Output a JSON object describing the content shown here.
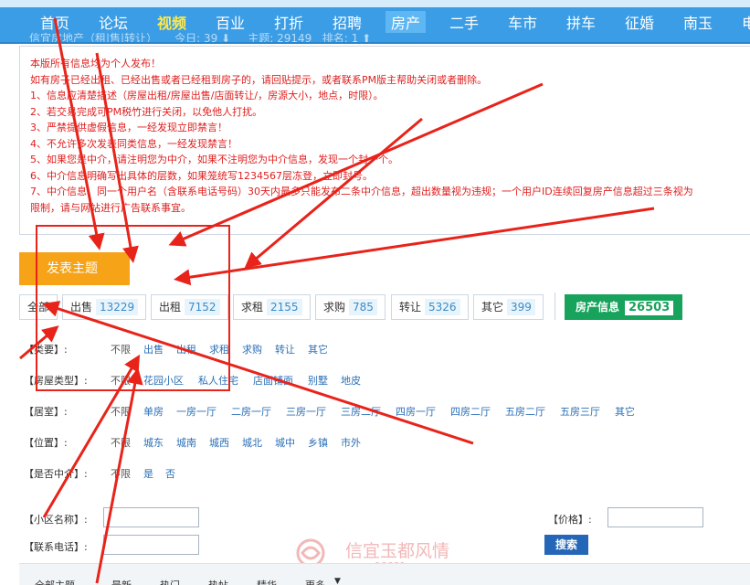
{
  "nav": {
    "items": [
      {
        "label": "首页",
        "style": "normal"
      },
      {
        "label": "论坛",
        "style": "normal"
      },
      {
        "label": "视频",
        "style": "hot"
      },
      {
        "label": "百业",
        "style": "normal"
      },
      {
        "label": "打折",
        "style": "normal"
      },
      {
        "label": "招聘",
        "style": "normal"
      },
      {
        "label": "房产",
        "style": "active"
      },
      {
        "label": "二手",
        "style": "normal"
      },
      {
        "label": "车市",
        "style": "normal"
      },
      {
        "label": "拼车",
        "style": "normal"
      },
      {
        "label": "征婚",
        "style": "normal"
      },
      {
        "label": "南玉",
        "style": "normal"
      },
      {
        "label": "电",
        "style": "normal"
      }
    ]
  },
  "forum": {
    "title": "信宜房地产（租|售|转让）",
    "today": "今日: 39",
    "topics": "主题: 29149",
    "rank": "排名: 1"
  },
  "notice": {
    "lines": [
      "本版所有信息均为个人发布！",
      "如有房子已经出租、已经出售或者已经租到房子的，请回贴提示，或者联系PM版主帮助关闭或者删除。",
      "1、信息应清楚描述（房屋出租/房屋出售/店面转让/，房源大小，地点，时限）。",
      "2、若交易完成可PM税竹进行关闭，以免他人打扰。",
      "3、严禁提供虚假信息，一经发现立即禁言！",
      "4、不允许多次发表同类信息，一经发现禁言！",
      "5、如果您是中介，请注明您为中介，如果不注明您为中介信息，发现一个封一个。",
      "6、中介信息明确写出具体的层数，如果笼统写1234567层冻登，立即封号。",
      "7、中介信息，同一个用户名（含联系电话号码）30天内最多只能发布二条中介信息，超出数量视为违规；一个用户ID连续回复房产信息超过三条视为",
      "限制，请与网站进行广告联系事宜。"
    ]
  },
  "post_button": "发表主题",
  "categories": [
    {
      "label": "全部",
      "count": ""
    },
    {
      "label": "出售",
      "count": "13229"
    },
    {
      "label": "出租",
      "count": "7152"
    },
    {
      "label": "求租",
      "count": "2155"
    },
    {
      "label": "求购",
      "count": "785"
    },
    {
      "label": "转让",
      "count": "5326"
    },
    {
      "label": "其它",
      "count": "399"
    }
  ],
  "stat": {
    "label": "房产信息",
    "count": "26503"
  },
  "filters": [
    {
      "label": "【类要】:",
      "options": [
        "不限",
        "出售",
        "出租",
        "求租",
        "求购",
        "转让",
        "其它"
      ]
    },
    {
      "label": "【房屋类型】:",
      "options": [
        "不限",
        "花园小区",
        "私人住宅",
        "店面铺面",
        "别墅",
        "地皮"
      ]
    },
    {
      "label": "【居室】:",
      "options": [
        "不限",
        "单房",
        "一房一厅",
        "二房一厅",
        "三房一厅",
        "三房二厅",
        "四房一厅",
        "四房二厅",
        "五房二厅",
        "五房三厅",
        "其它"
      ]
    },
    {
      "label": "【位置】:",
      "options": [
        "不限",
        "城东",
        "城南",
        "城西",
        "城北",
        "城中",
        "乡镇",
        "市外"
      ]
    },
    {
      "label": "【是否中介】:",
      "options": [
        "不限",
        "是",
        "否"
      ]
    }
  ],
  "form": {
    "community_label": "【小区名称】:",
    "phone_label": "【联系电话】:",
    "price_label": "【价格】:",
    "search_label": "搜索"
  },
  "bottom_tabs": [
    "全部主题",
    "最新",
    "热门",
    "热帖",
    "精华",
    "更多"
  ],
  "watermark": {
    "title": "信宜玉都风情",
    "url": "www.06681.com"
  },
  "colors": {
    "nav_bg": "#3a9de6",
    "notice_text": "#e02020",
    "post_button": "#f6a318",
    "stat_button": "#18a35c",
    "annotation": "#e8231a",
    "search_button": "#2466b8"
  }
}
